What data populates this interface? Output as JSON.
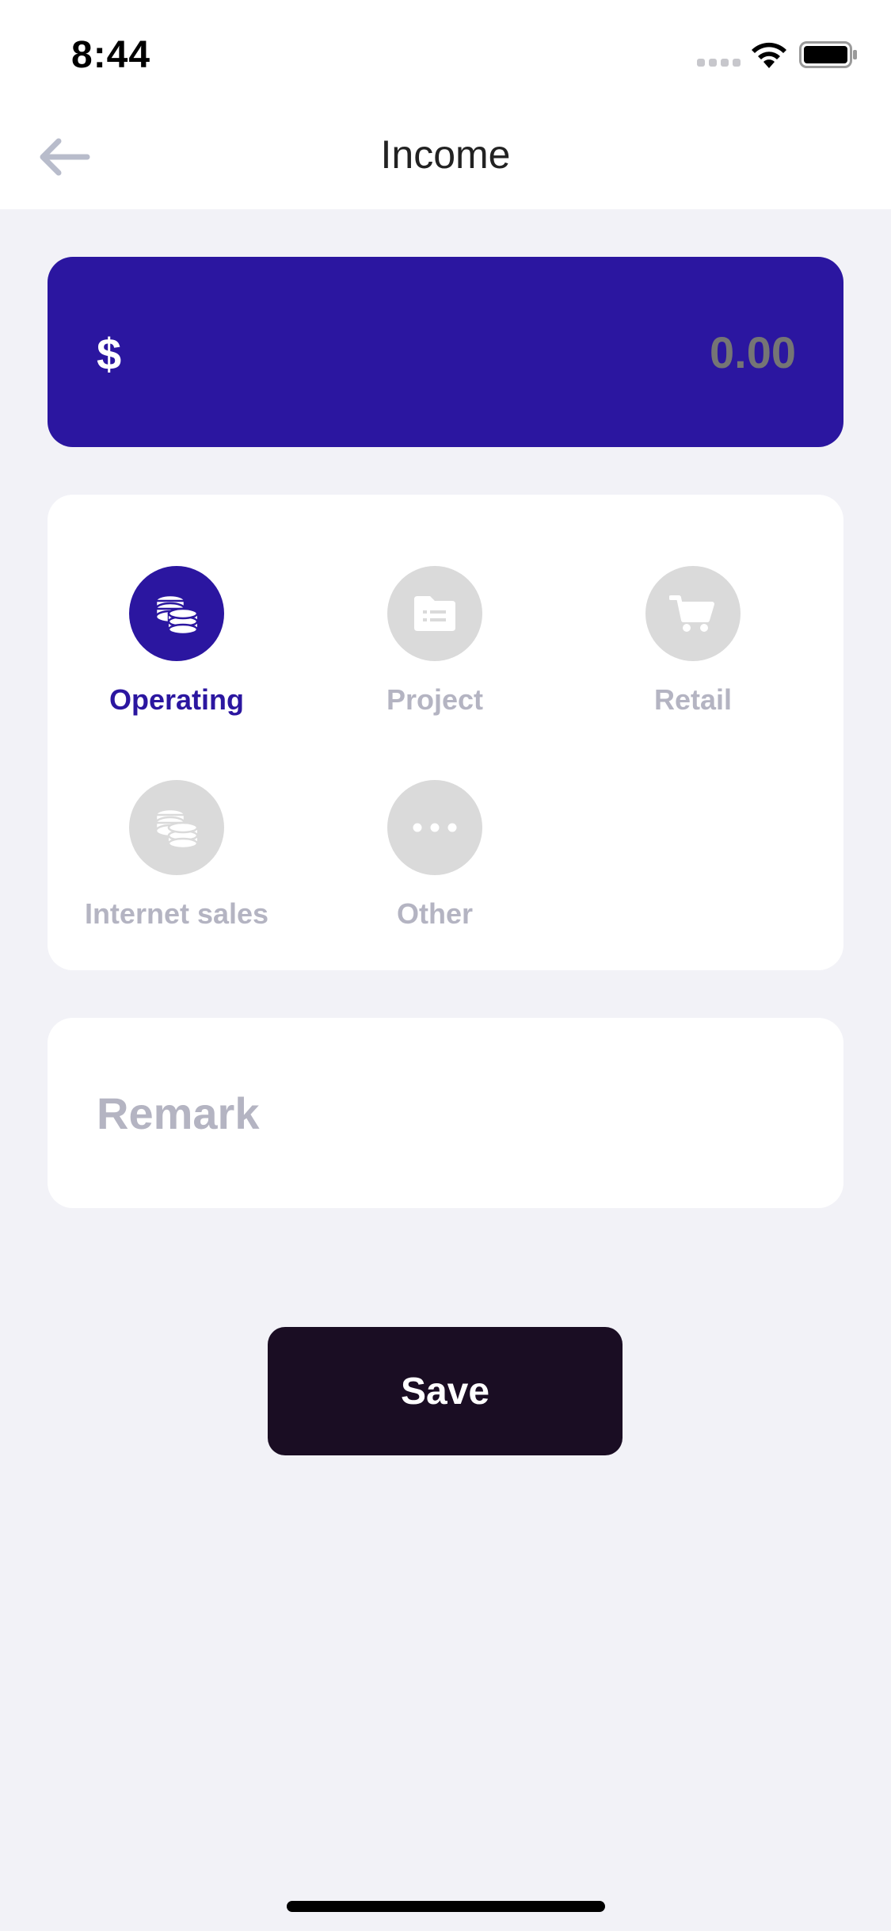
{
  "status_bar": {
    "time": "8:44"
  },
  "nav": {
    "title": "Income",
    "back_icon": "arrow-left-icon"
  },
  "amount": {
    "currency_symbol": "$",
    "placeholder": "0.00",
    "value": ""
  },
  "categories": [
    {
      "label": "Operating",
      "icon": "coins-stack-icon",
      "selected": true
    },
    {
      "label": "Project",
      "icon": "folder-list-icon",
      "selected": false
    },
    {
      "label": "Retail",
      "icon": "shopping-cart-icon",
      "selected": false
    },
    {
      "label": "Internet sales",
      "icon": "coins-stack-icon",
      "selected": false
    },
    {
      "label": "Other",
      "icon": "more-dots-icon",
      "selected": false
    }
  ],
  "remark": {
    "placeholder": "Remark",
    "value": ""
  },
  "save": {
    "label": "Save"
  },
  "colors": {
    "accent": "#2b16a0",
    "amount_placeholder": "#a39ad8",
    "inactive": "#b4b4c2",
    "save_button": "#1a0d23",
    "background": "#f2f2f7"
  }
}
